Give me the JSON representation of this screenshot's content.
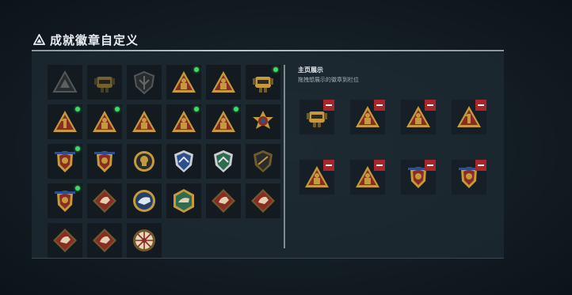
{
  "header": {
    "title": "成就徽章自定义",
    "icon": "triangle-badge-icon"
  },
  "colors": {
    "new_dot": "#3ddc67",
    "remove": "#a5262b",
    "gold": "#c59a3c"
  },
  "badges": [
    {
      "icon": "triangle-emblem-icon",
      "new": false,
      "dim": true
    },
    {
      "icon": "mech-helmet-icon",
      "new": false,
      "dim": true
    },
    {
      "icon": "shield-wing-icon",
      "new": false,
      "dim": true
    },
    {
      "icon": "triangle-soldier-icon",
      "new": true,
      "dim": false
    },
    {
      "icon": "triangle-soldier-icon",
      "new": false,
      "dim": false
    },
    {
      "icon": "mech-helmet-icon",
      "new": true,
      "dim": false
    },
    {
      "icon": "triangle-number-one-icon",
      "new": true,
      "dim": false
    },
    {
      "icon": "triangle-soldier-icon",
      "new": true,
      "dim": false
    },
    {
      "icon": "triangle-soldier-icon",
      "new": false,
      "dim": false
    },
    {
      "icon": "triangle-soldier-icon",
      "new": true,
      "dim": false
    },
    {
      "icon": "triangle-soldier-icon",
      "new": true,
      "dim": false
    },
    {
      "icon": "gold-medal-icon",
      "new": false,
      "dim": false
    },
    {
      "icon": "crest-shield-icon",
      "new": true,
      "dim": false
    },
    {
      "icon": "crest-shield-icon",
      "new": false,
      "dim": false
    },
    {
      "icon": "round-skull-icon",
      "new": false,
      "dim": false
    },
    {
      "icon": "blue-shield-icon",
      "new": false,
      "dim": false
    },
    {
      "icon": "green-shield-icon",
      "new": false,
      "dim": false
    },
    {
      "icon": "bronze-shield-icon",
      "new": false,
      "dim": false
    },
    {
      "icon": "crest-shield-icon",
      "new": true,
      "dim": false
    },
    {
      "icon": "diamond-beast-icon",
      "new": false,
      "dim": false
    },
    {
      "icon": "round-blue-beast-icon",
      "new": false,
      "dim": false
    },
    {
      "icon": "green-hex-icon",
      "new": false,
      "dim": false
    },
    {
      "icon": "diamond-beast-icon",
      "new": false,
      "dim": false
    },
    {
      "icon": "diamond-beast-icon",
      "new": false,
      "dim": false
    },
    {
      "icon": "diamond-beast-icon",
      "new": false,
      "dim": false
    },
    {
      "icon": "diamond-beast-icon",
      "new": false,
      "dim": false
    },
    {
      "icon": "round-wheel-icon",
      "new": false,
      "dim": false
    }
  ],
  "showcase": {
    "title": "主页展示",
    "subtitle": "拖拽想展示的徽章到栏位",
    "slots": [
      {
        "icon": "mech-helmet-icon"
      },
      {
        "icon": "triangle-soldier-icon"
      },
      {
        "icon": "triangle-soldier-icon"
      },
      {
        "icon": "triangle-number-one-icon"
      },
      {
        "icon": "triangle-soldier-icon"
      },
      {
        "icon": "triangle-soldier-icon"
      },
      {
        "icon": "crest-shield-icon"
      },
      {
        "icon": "crest-shield-icon"
      }
    ]
  }
}
